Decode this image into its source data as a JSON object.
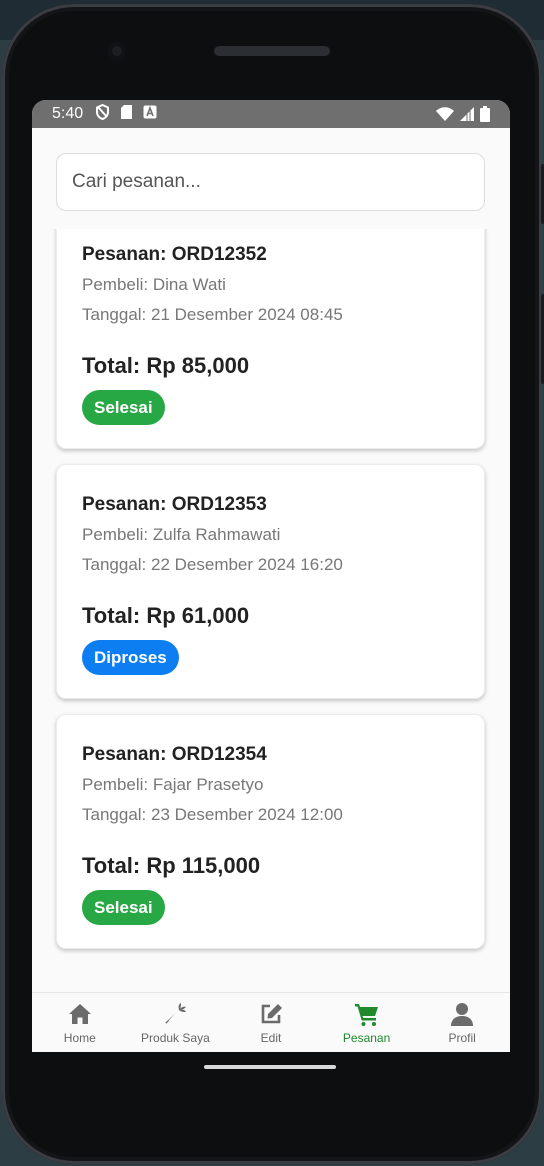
{
  "status": {
    "time": "5:40"
  },
  "search": {
    "placeholder": "Cari pesanan..."
  },
  "orders": [
    {
      "title": "Pesanan: ORD12352",
      "buyer": "Pembeli: Dina Wati",
      "date": "Tanggal: 21 Desember 2024 08:45",
      "total": "Total: Rp 85,000",
      "status": "Selesai",
      "status_color": "#28a745"
    },
    {
      "title": "Pesanan: ORD12353",
      "buyer": "Pembeli: Zulfa Rahmawati",
      "date": "Tanggal: 22 Desember 2024 16:20",
      "total": "Total: Rp 61,000",
      "status": "Diproses",
      "status_color": "#0d7ef2"
    },
    {
      "title": "Pesanan: ORD12354",
      "buyer": "Pembeli: Fajar Prasetyo",
      "date": "Tanggal: 23 Desember 2024 12:00",
      "total": "Total: Rp 115,000",
      "status": "Selesai",
      "status_color": "#28a745"
    }
  ],
  "nav": [
    {
      "label": "Home",
      "icon": "home-icon",
      "active": false
    },
    {
      "label": "Produk Saya",
      "icon": "carrot-icon",
      "active": false
    },
    {
      "label": "Edit",
      "icon": "edit-icon",
      "active": false
    },
    {
      "label": "Pesanan",
      "icon": "cart-icon",
      "active": true
    },
    {
      "label": "Profil",
      "icon": "user-icon",
      "active": false
    }
  ],
  "colors": {
    "active_nav": "#1f8a2c",
    "selesai": "#28a745",
    "diproses": "#0d7ef2"
  }
}
